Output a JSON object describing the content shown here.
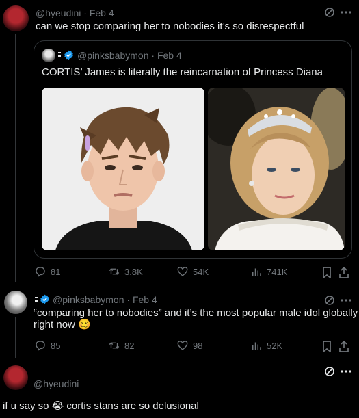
{
  "tweet1": {
    "handle": "@hyeudini",
    "date": "Feb 4",
    "text": "can we stop comparing her to nobodies it’s so disrespectful"
  },
  "quote": {
    "handle": "@pinksbabymon",
    "date": "Feb 4",
    "text": "CORTIS’ James is literally the reincarnation of Princess Diana",
    "media": [
      {
        "depicts": "young man with spiky brown hair"
      },
      {
        "depicts": "woman wearing tiara"
      }
    ]
  },
  "tweet1_actions": {
    "replies": "81",
    "retweets": "3.8K",
    "likes": "54K",
    "views": "741K"
  },
  "tweet2": {
    "handle": "@pinksbabymon",
    "date": "Feb 4",
    "text_line1": "“comparing her to nobodies” and it’s the most popular male idol globally",
    "text_line2": "right now",
    "emoji": "🥴"
  },
  "tweet2_actions": {
    "replies": "85",
    "retweets": "82",
    "likes": "98",
    "views": "52K"
  },
  "reply_box": {
    "handle": "@hyeudini",
    "text_before": "if u say so",
    "emoji": "😭",
    "text_after": "cortis stans are so delusional"
  },
  "colors": {
    "background": "#000000",
    "text": "#e7e9ea",
    "muted": "#71767b",
    "border": "#2f3336",
    "verified": "#1d9bf0"
  },
  "icons": [
    "grok-icon",
    "more-icon",
    "reply-icon",
    "retweet-icon",
    "like-icon",
    "views-icon",
    "bookmark-icon",
    "share-icon",
    "verified-badge-icon"
  ]
}
